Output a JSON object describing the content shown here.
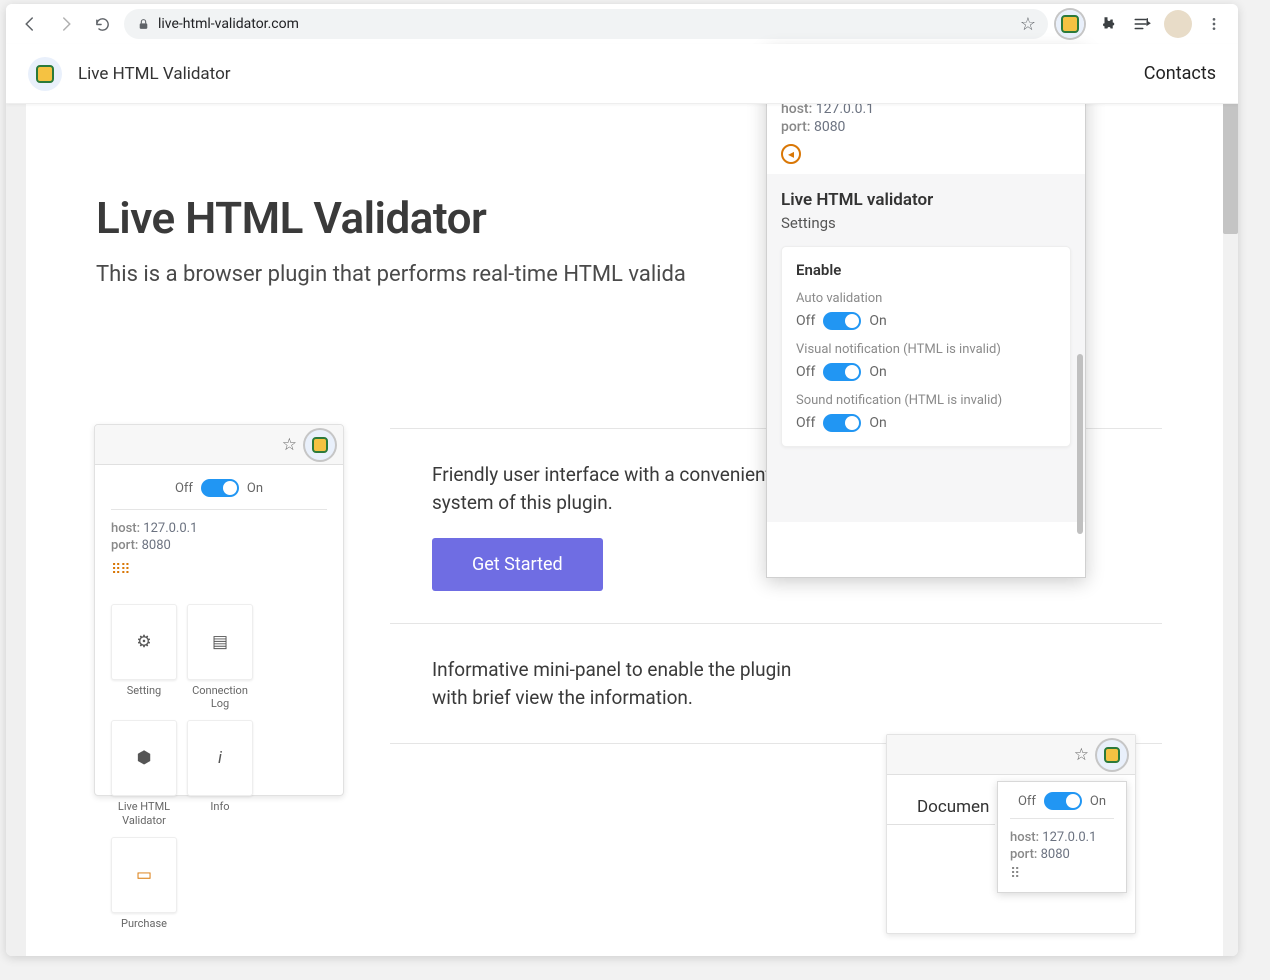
{
  "url": "live-html-validator.com",
  "header": {
    "title": "Live HTML Validator",
    "contacts": "Contacts"
  },
  "hero": {
    "h1": "Live HTML Validator",
    "sub": "This is a browser plugin that performs real-time HTML valida"
  },
  "features": {
    "f1": "Friendly user interface with a convenient ",
    "f1b": "system of this plugin.",
    "cta": "Get Started",
    "f2a": "Informative mini-panel to enable the plugin",
    "f2b": "with brief view the information."
  },
  "toggle": {
    "off": "Off",
    "on": "On"
  },
  "conn": {
    "hostLabel": "host:",
    "host": "127.0.0.1",
    "portLabel": "port:",
    "port": "8080"
  },
  "tiles": {
    "setting": "Setting",
    "connlog": "Connection Log",
    "validator": "Live HTML Validator",
    "info": "Info",
    "purchase": "Purchase"
  },
  "popup": {
    "title": "Live HTML validator",
    "settings": "Settings",
    "enable": "Enable",
    "autoValidation": "Auto validation",
    "visual": "Visual notification (HTML is invalid)",
    "sound": "Sound notification (HTML is invalid)"
  },
  "doc": "Documen"
}
